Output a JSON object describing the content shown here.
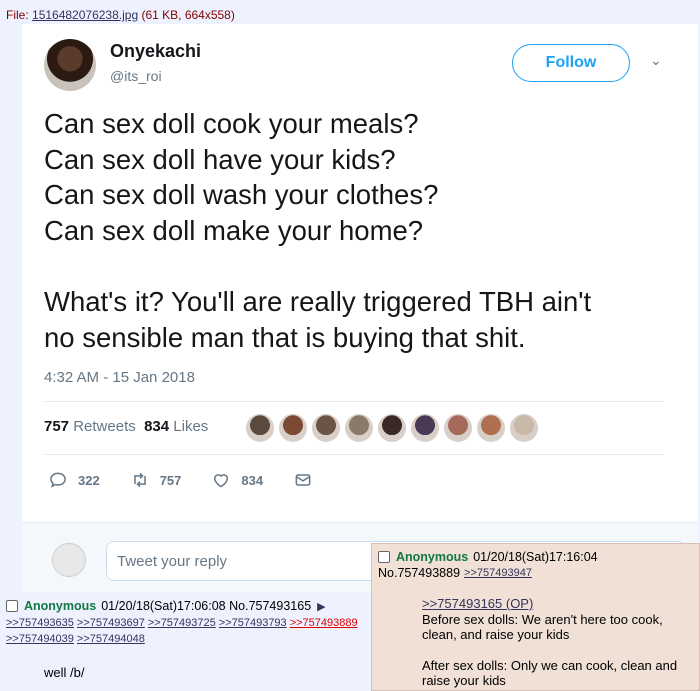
{
  "file_info": {
    "prefix": "File: ",
    "filename": "1516482076238.jpg",
    "meta": " (61 KB, 664x558)"
  },
  "tweet": {
    "display_name": "Onyekachi",
    "handle": "@its_roi",
    "follow_label": "Follow",
    "lines": [
      "Can sex doll cook your meals?",
      "Can sex doll have your kids?",
      "Can sex doll wash your clothes?",
      "Can sex doll make your home?",
      "What's it? You'll are really triggered TBH ain't",
      "no sensible man that is buying that shit."
    ],
    "timestamp": "4:32 AM - 15 Jan 2018",
    "retweets_count": "757",
    "retweets_label": "Retweets",
    "likes_count": "834",
    "likes_label": "Likes",
    "reply_count": "322",
    "retweet_action_count": "757",
    "like_action_count": "834",
    "reply_placeholder": "Tweet your reply",
    "liker_colors": [
      "#5b4a3e",
      "#7a4a35",
      "#6b5345",
      "#8a7a6a",
      "#3a2a25",
      "#4a3a55",
      "#a56a5a",
      "#b07050",
      "#c8b8a8"
    ],
    "accent_color": "#1da1f2"
  },
  "post_left": {
    "name": "Anonymous",
    "datetime": "01/20/18(Sat)17:06:08",
    "number": "No.757493165",
    "backlinks": [
      ">>757493635",
      ">>757493697",
      ">>757493725",
      ">>757493793",
      ">>757493889",
      ">>757494039",
      ">>757494048"
    ],
    "text": "well /b/"
  },
  "post_hover": {
    "name": "Anonymous",
    "datetime": "01/20/18(Sat)17:16:04",
    "number": "No.757493889",
    "backlink": ">>757493947",
    "quote": ">>757493165 (OP)",
    "para1": "Before sex dolls: We aren't here too cook, clean, and raise your kids",
    "para2": "After sex dolls: Only we can cook, clean and raise your kids"
  }
}
